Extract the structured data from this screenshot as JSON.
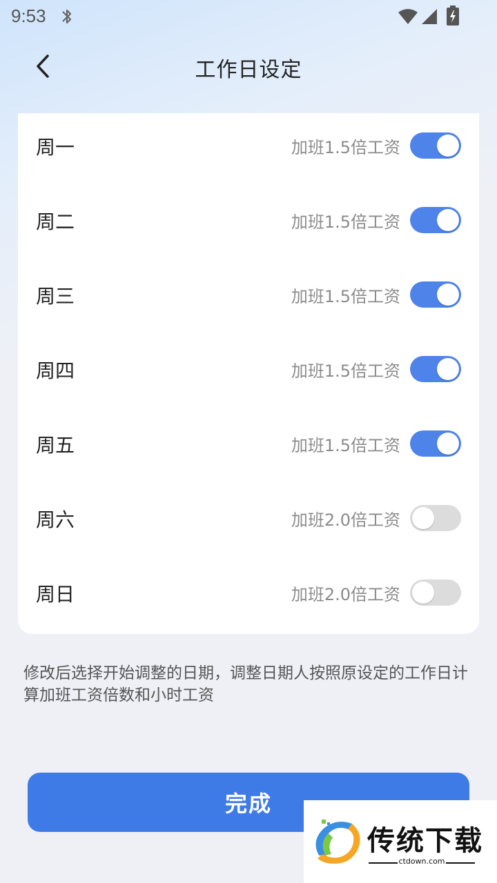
{
  "status_bar": {
    "time": "9:53"
  },
  "header": {
    "title": "工作日设定"
  },
  "days": [
    {
      "day": "周一",
      "rate": "加班1.5倍工资",
      "enabled": true
    },
    {
      "day": "周二",
      "rate": "加班1.5倍工资",
      "enabled": true
    },
    {
      "day": "周三",
      "rate": "加班1.5倍工资",
      "enabled": true
    },
    {
      "day": "周四",
      "rate": "加班1.5倍工资",
      "enabled": true
    },
    {
      "day": "周五",
      "rate": "加班1.5倍工资",
      "enabled": true
    },
    {
      "day": "周六",
      "rate": "加班2.0倍工资",
      "enabled": false
    },
    {
      "day": "周日",
      "rate": "加班2.0倍工资",
      "enabled": false
    }
  ],
  "note": "修改后选择开始调整的日期，调整日期人按照原设定的工作日计算加班工资倍数和小时工资",
  "done_label": "完成",
  "watermark": {
    "title": "传统下载",
    "url": "ctdown.com"
  },
  "colors": {
    "accent": "#3f7be6",
    "toggle_on": "#4e83ea",
    "toggle_off": "#dcdcdc"
  }
}
